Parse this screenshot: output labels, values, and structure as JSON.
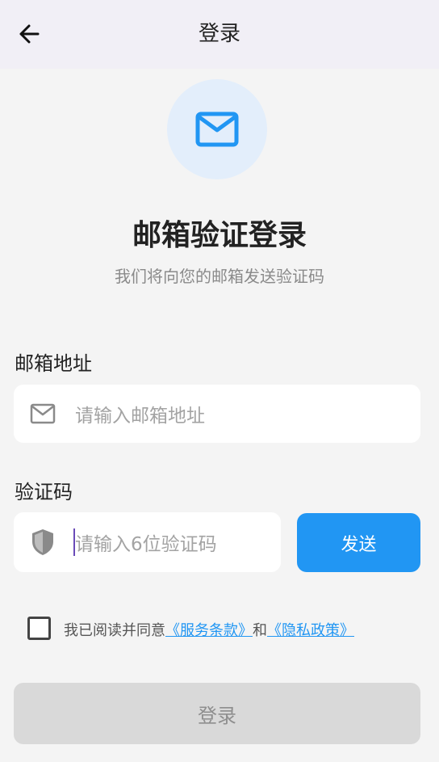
{
  "header": {
    "title": "登录",
    "back_icon": "arrow-left-icon"
  },
  "hero": {
    "icon": "mail-icon",
    "title": "邮箱验证登录",
    "subtitle": "我们将向您的邮箱发送验证码"
  },
  "email": {
    "label": "邮箱地址",
    "placeholder": "请输入邮箱地址",
    "value": "",
    "icon": "mail-icon"
  },
  "code": {
    "label": "验证码",
    "placeholder": "请输入6位验证码",
    "value": "",
    "icon": "shield-icon",
    "send_label": "发送"
  },
  "agreement": {
    "checked": false,
    "prefix": "我已阅读并同意",
    "terms": "《服务条款》",
    "conjunction": "和",
    "privacy": "《隐私政策》"
  },
  "login_button": {
    "label": "登录",
    "enabled": false
  },
  "colors": {
    "accent": "#2196f3",
    "topbar": "#f1eff6",
    "disabled": "#d9d9d9",
    "background": "#f4f4f4"
  }
}
